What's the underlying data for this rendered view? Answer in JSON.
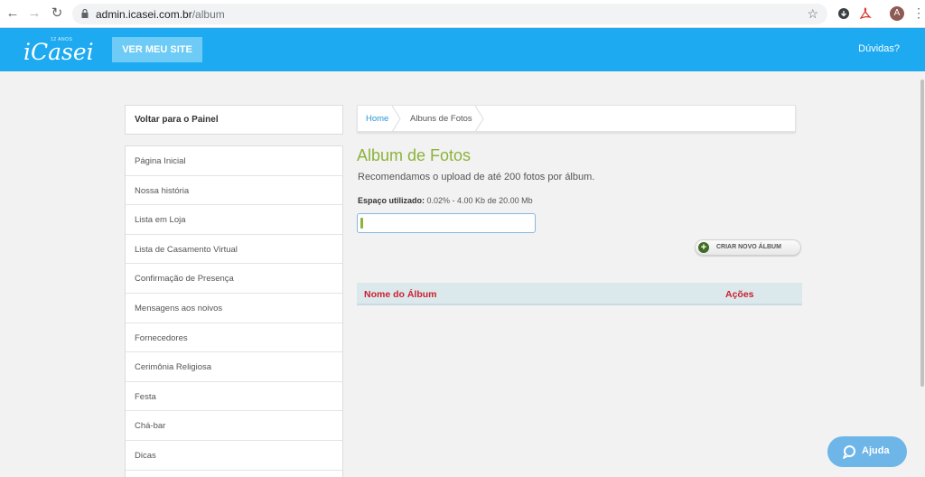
{
  "browser": {
    "url_host": "admin.icasei.com.br",
    "url_path": "/album",
    "avatar_letter": "A",
    "icons": [
      "back-icon",
      "forward-icon",
      "reload-icon",
      "lock-icon",
      "star-icon",
      "extension-icon",
      "pdf-icon",
      "menu-icon"
    ]
  },
  "header": {
    "logo_text": "iCasei",
    "logo_tagline": "12 ANOS",
    "site_button": "VER MEU SITE",
    "help_link": "Dúvidas?",
    "color": "#1eaaf1"
  },
  "sidebar": {
    "back_label": "Voltar para o Painel",
    "items": [
      {
        "label": "Página Inicial"
      },
      {
        "label": "Nossa história"
      },
      {
        "label": "Lista em Loja"
      },
      {
        "label": "Lista de Casamento Virtual"
      },
      {
        "label": "Confirmação de Presença"
      },
      {
        "label": "Mensagens aos noivos"
      },
      {
        "label": "Fornecedores"
      },
      {
        "label": "Cerimônia Religiosa"
      },
      {
        "label": "Festa"
      },
      {
        "label": "Chá-bar"
      },
      {
        "label": "Dicas"
      }
    ]
  },
  "breadcrumb": {
    "home": "Home",
    "current": "Albuns de Fotos"
  },
  "main": {
    "title": "Album de Fotos",
    "subtitle": "Recomendamos o upload de até 200 fotos por álbum.",
    "space_label": "Espaço utilizado:",
    "space_value": " 0.02% - 4.00 Kb de 20.00 Mb",
    "space_fraction": 0.0002,
    "create_button": "CRIAR NOVO ÁLBUM",
    "table": {
      "columns": [
        "Nome do Álbum",
        "Ações"
      ],
      "rows": []
    },
    "title_color": "#8db33a",
    "header_text_color": "#cc1f2e"
  },
  "help_widget": {
    "label": "Ajuda"
  }
}
